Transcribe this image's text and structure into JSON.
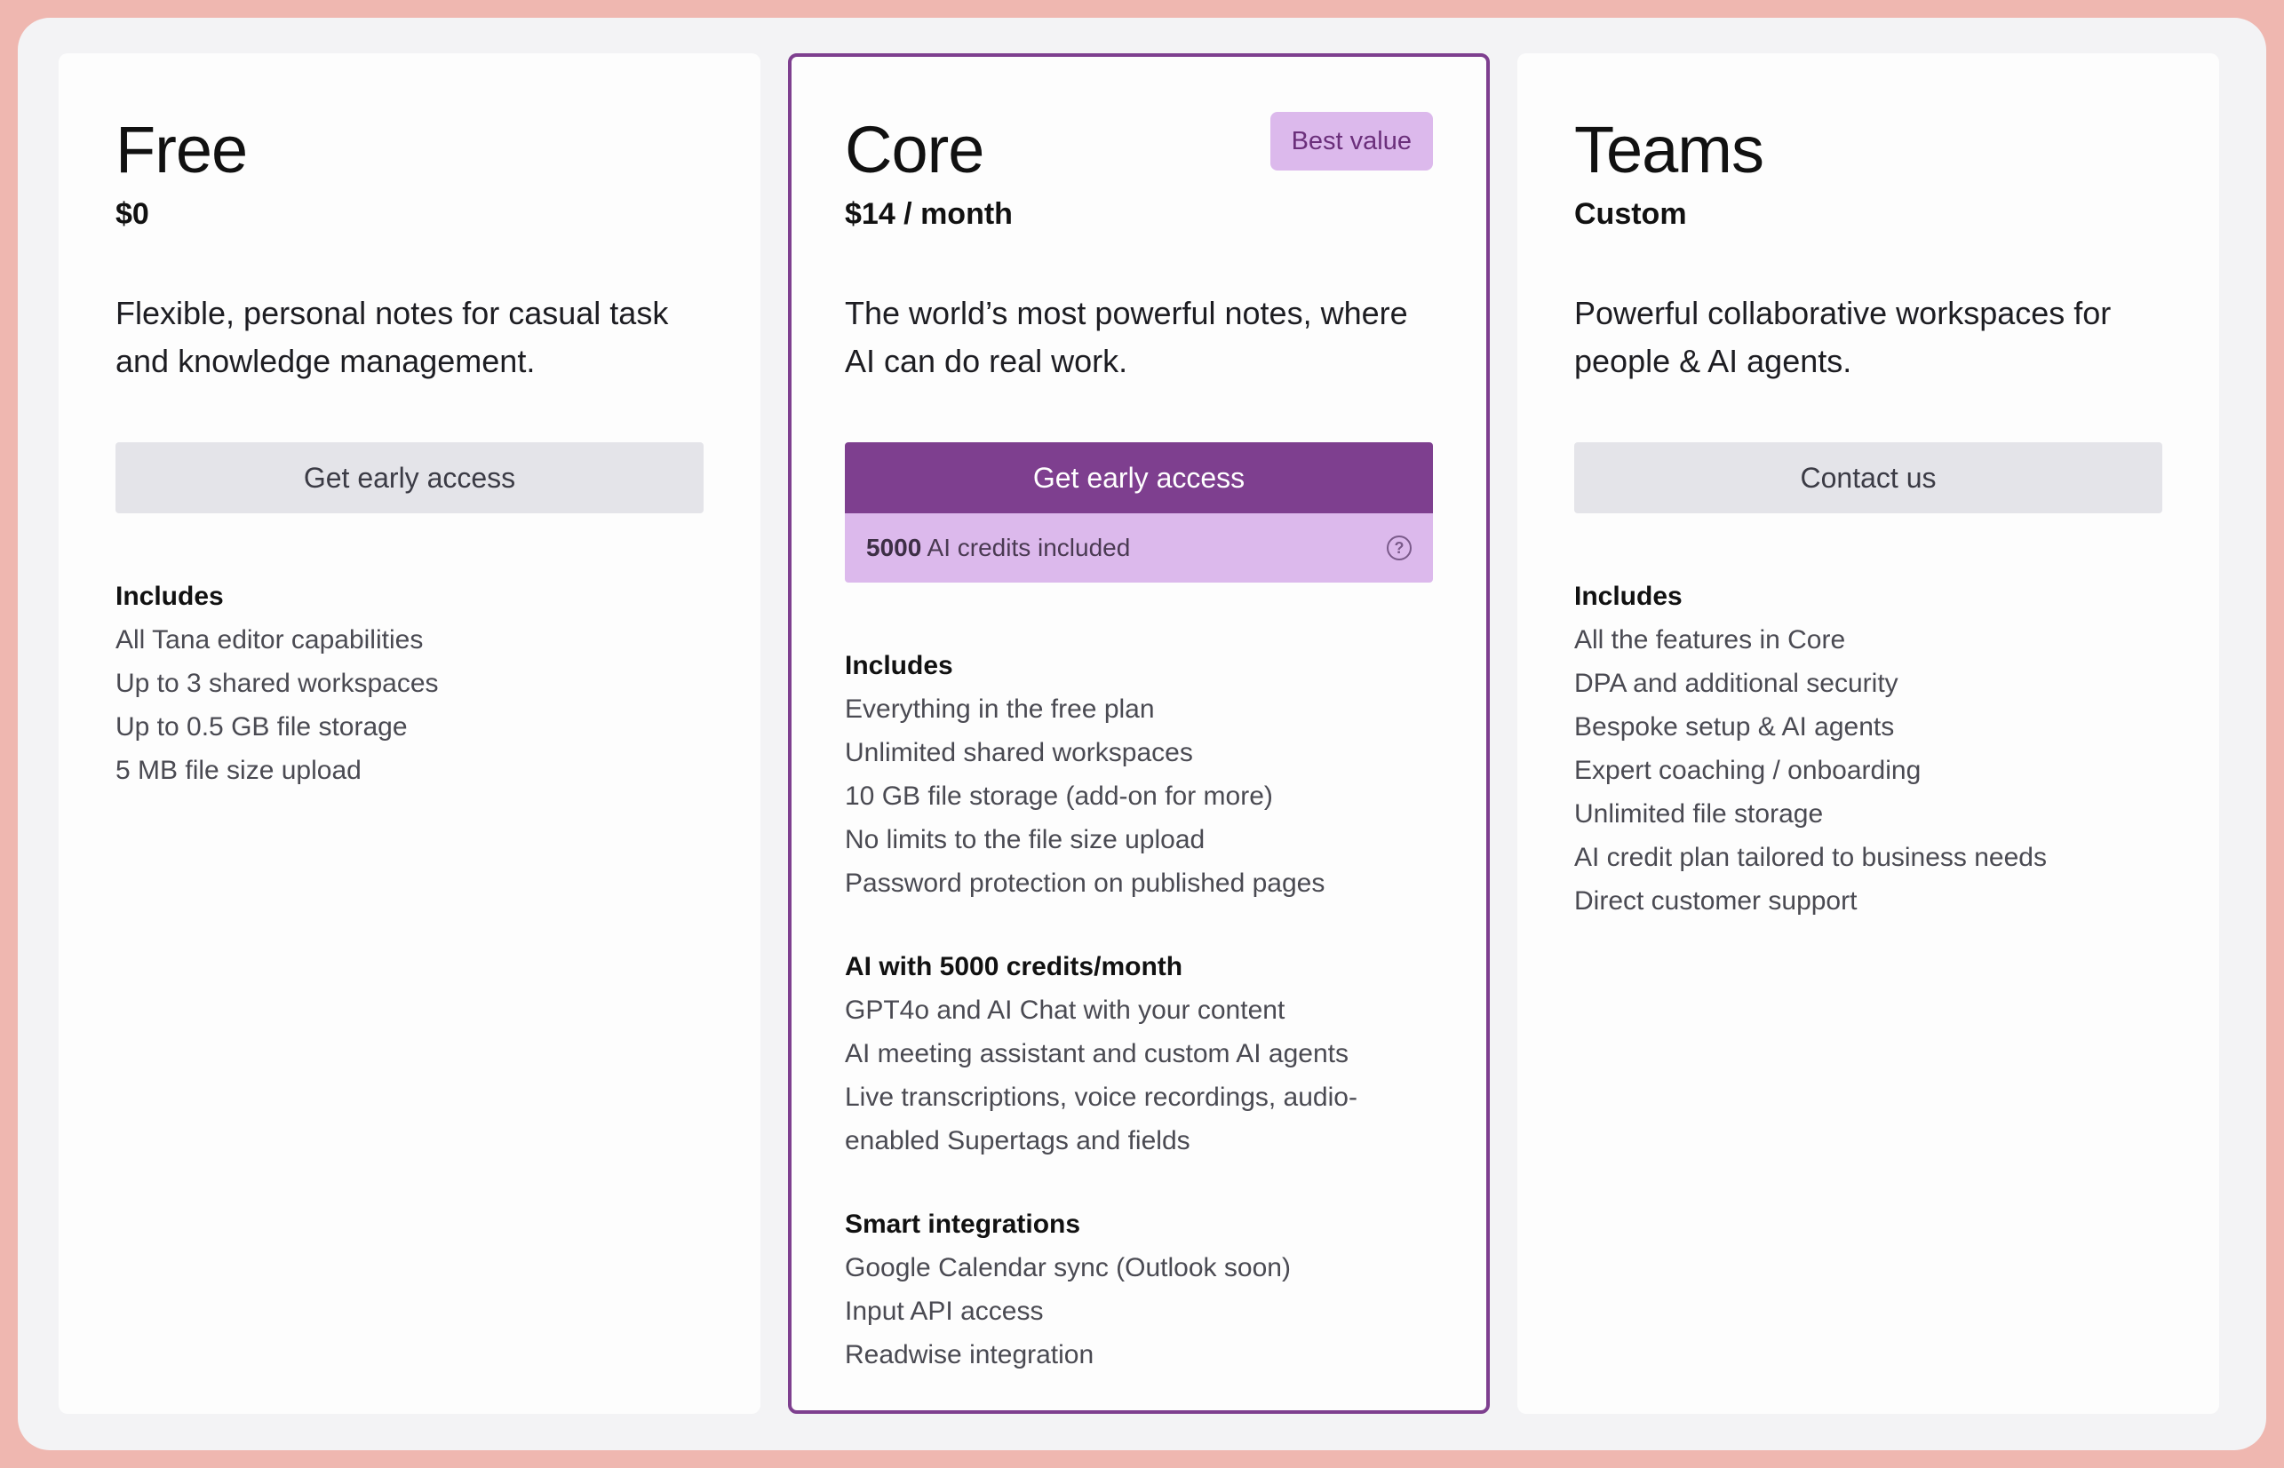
{
  "plans": [
    {
      "name": "Free",
      "price": "$0",
      "description": "Flexible, personal notes for casual task and knowledge management.",
      "button_label": "Get early access",
      "sections": [
        {
          "title": "Includes",
          "items": [
            "All Tana editor capabilities",
            "Up to 3 shared workspaces",
            "Up to 0.5 GB file storage",
            "5 MB file size upload"
          ]
        }
      ]
    },
    {
      "name": "Core",
      "badge": "Best value",
      "price": "$14 / month",
      "description": "The world’s most powerful notes, where AI can do real work.",
      "button_label": "Get early access",
      "credits": {
        "amount": "5000",
        "label": "AI credits included"
      },
      "sections": [
        {
          "title": "Includes",
          "items": [
            "Everything in the free plan",
            "Unlimited shared workspaces",
            "10 GB file storage (add-on for more)",
            "No limits to the file size upload",
            "Password protection on published pages"
          ]
        },
        {
          "title": "AI with 5000 credits/month",
          "items": [
            "GPT4o and AI Chat with your content",
            "AI meeting assistant and custom AI agents",
            "Live transcriptions, voice recordings, audio-enabled Supertags and fields"
          ]
        },
        {
          "title": "Smart integrations",
          "items": [
            "Google Calendar sync (Outlook soon)",
            "Input API access",
            "Readwise integration"
          ]
        }
      ]
    },
    {
      "name": "Teams",
      "price": "Custom",
      "description": "Powerful collaborative workspaces for people & AI agents.",
      "button_label": "Contact us",
      "sections": [
        {
          "title": "Includes",
          "items": [
            "All the features in Core",
            "DPA and additional security",
            "Bespoke setup & AI agents",
            "Expert coaching / onboarding",
            "Unlimited file storage",
            "AI credit plan tailored to business needs",
            "Direct customer support"
          ]
        }
      ]
    }
  ],
  "colors": {
    "accent": "#7e3f8f",
    "badge_bg": "#dcb9ec",
    "page_bg": "#efb7b0"
  },
  "icons": {
    "credits_help": "question-circle-icon"
  }
}
